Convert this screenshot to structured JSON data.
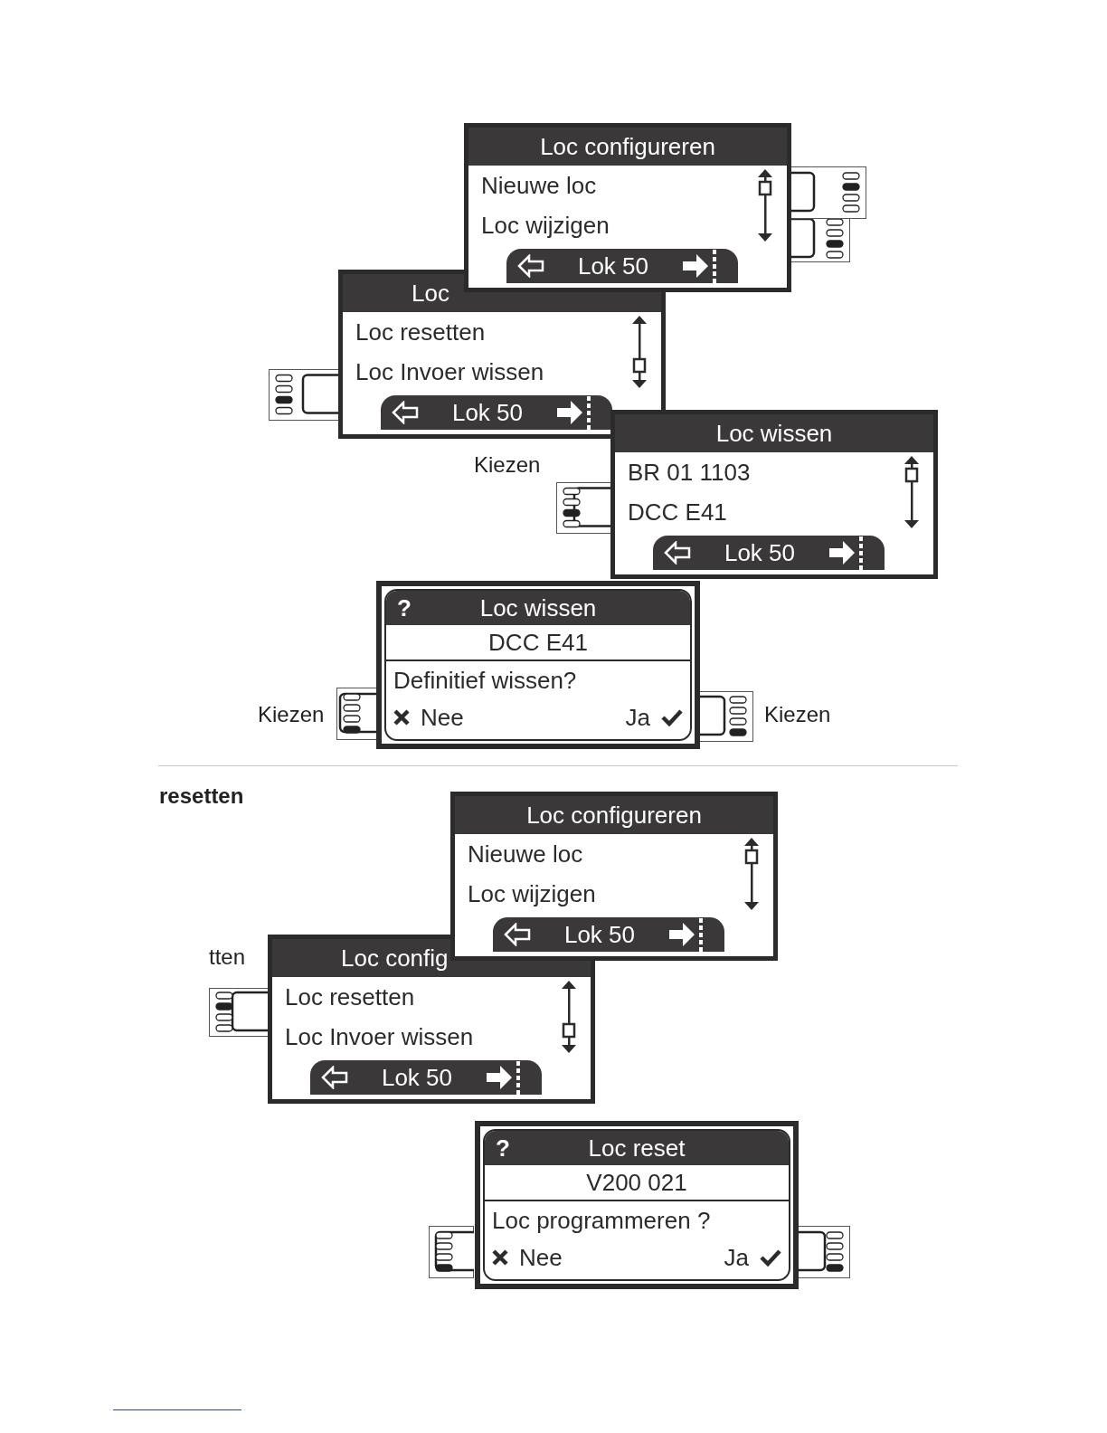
{
  "heading": "resetten",
  "captions": [
    {
      "text": "Kiezen"
    },
    {
      "text": "Kiezen"
    },
    {
      "text": "Kiezen"
    },
    {
      "text": "tten"
    }
  ],
  "screens": [
    {
      "kind": "menu",
      "title": "Loc configureren",
      "items": [
        "Nieuwe loc",
        "Loc wijzigen"
      ],
      "tab": "Lok 50",
      "keys": [
        {
          "bars": [
            {
              "on": false
            },
            {
              "on": true
            },
            {
              "on": false
            },
            {
              "on": false
            }
          ]
        },
        {
          "bars": [
            {
              "on": false
            },
            {
              "on": false
            },
            {
              "on": true
            },
            {
              "on": false
            }
          ]
        }
      ]
    },
    {
      "kind": "menu",
      "title": "Loc",
      "items": [
        "Loc resetten",
        "Loc Invoer wissen"
      ],
      "tab": "Lok 50",
      "keys": [
        {
          "bars": [
            {
              "on": false
            },
            {
              "on": false
            },
            {
              "on": true
            },
            {
              "on": false
            }
          ]
        }
      ]
    },
    {
      "kind": "menu",
      "title": "Loc wissen",
      "items": [
        "BR 01 1103",
        "DCC E41"
      ],
      "tab": "Lok 50",
      "keys": [
        {
          "bars": [
            {
              "on": false
            },
            {
              "on": false
            },
            {
              "on": true
            },
            {
              "on": false
            }
          ]
        }
      ]
    },
    {
      "kind": "dialog",
      "icon": "?",
      "title": "Loc wissen",
      "subject": "DCC E41",
      "question": "Definitief wissen?",
      "no": "Nee",
      "yes": "Ja",
      "keys": [
        {
          "bars": [
            {
              "on": false
            },
            {
              "on": false
            },
            {
              "on": false
            },
            {
              "on": true
            }
          ]
        },
        {
          "bars": [
            {
              "on": false
            },
            {
              "on": false
            },
            {
              "on": false
            },
            {
              "on": true
            }
          ]
        }
      ]
    },
    {
      "kind": "menu",
      "title": "Loc configureren",
      "items": [
        "Nieuwe loc",
        "Loc wijzigen"
      ],
      "tab": "Lok 50"
    },
    {
      "kind": "menu",
      "title": "Loc config",
      "items": [
        "Loc resetten",
        "Loc Invoer wissen"
      ],
      "tab": "Lok 50",
      "keys": [
        {
          "bars": [
            {
              "on": false
            },
            {
              "on": true
            },
            {
              "on": false
            },
            {
              "on": false
            }
          ]
        }
      ]
    },
    {
      "kind": "dialog",
      "icon": "?",
      "title": "Loc reset",
      "subject": "V200 021",
      "question": "Loc programmeren ?",
      "no": "Nee",
      "yes": "Ja",
      "keys": [
        {
          "bars": [
            {
              "on": false
            },
            {
              "on": false
            },
            {
              "on": false
            },
            {
              "on": true
            }
          ]
        },
        {
          "bars": [
            {
              "on": false
            },
            {
              "on": false
            },
            {
              "on": false
            },
            {
              "on": true
            }
          ]
        }
      ]
    }
  ]
}
